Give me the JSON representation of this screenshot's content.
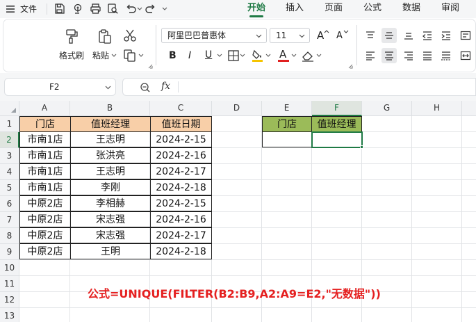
{
  "menu": {
    "file_label": "文件",
    "tabs": [
      {
        "label": "开始",
        "active": true
      },
      {
        "label": "插入",
        "active": false
      },
      {
        "label": "页面",
        "active": false
      },
      {
        "label": "公式",
        "active": false
      },
      {
        "label": "数据",
        "active": false
      },
      {
        "label": "审阅",
        "active": false
      }
    ]
  },
  "ribbon": {
    "format_painter_label": "格式刷",
    "paste_label": "粘贴",
    "font_name": "阿里巴巴普惠体",
    "font_size": "11",
    "increase_font_glyph": "A",
    "decrease_font_glyph": "A",
    "bold_glyph": "B",
    "italic_glyph": "I",
    "underline_glyph": "U",
    "font_color_glyph": "A",
    "font_color": "#e02020",
    "fill_color": "#f5c400"
  },
  "formula_bar": {
    "name_box": "F2",
    "fx_label": "fx",
    "formula": ""
  },
  "sheet": {
    "columns": [
      "A",
      "B",
      "C",
      "D",
      "E",
      "F",
      "G",
      "H"
    ],
    "active_column": "F",
    "rows": [
      "1",
      "2",
      "3",
      "4",
      "5",
      "6",
      "7",
      "8",
      "9",
      "10",
      "11",
      "12",
      "13"
    ],
    "active_row": "2",
    "table_headers": [
      "门店",
      "值班经理",
      "值班日期"
    ],
    "table_rows": [
      [
        "市南1店",
        "王志明",
        "2024-2-15"
      ],
      [
        "市南1店",
        "张洪亮",
        "2024-2-16"
      ],
      [
        "市南1店",
        "王志明",
        "2024-2-17"
      ],
      [
        "市南1店",
        "李刚",
        "2024-2-18"
      ],
      [
        "中原2店",
        "李相赫",
        "2024-2-15"
      ],
      [
        "中原2店",
        "宋志强",
        "2024-2-16"
      ],
      [
        "中原2店",
        "宋志强",
        "2024-2-17"
      ],
      [
        "中原2店",
        "王明",
        "2024-2-18"
      ]
    ],
    "lookup_headers": [
      "门店",
      "值班经理"
    ],
    "lookup_values": [
      "",
      ""
    ]
  },
  "annotation": "公式=UNIQUE(FILTER(B2:B9,A2:A9=E2,\"无数据\"))"
}
